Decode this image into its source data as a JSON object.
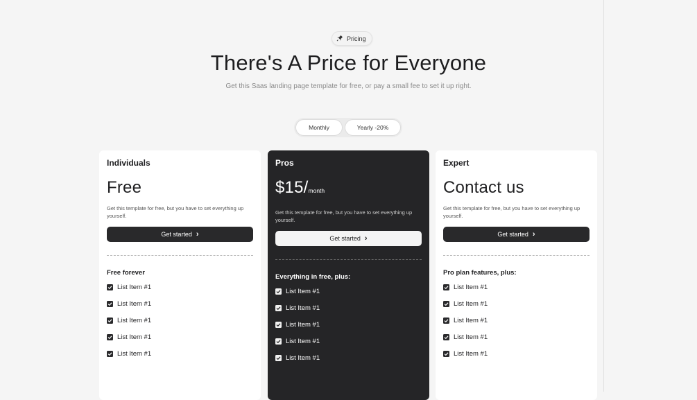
{
  "header": {
    "badge_label": "Pricing",
    "badge_icon": "rocket-icon",
    "title": "There's A Price for Everyone",
    "subtitle": "Get this Saas landing page template for free, or pay a small fee to set it up right."
  },
  "billing_toggle": {
    "monthly_label": "Monthly",
    "yearly_label": "Yearly -20%"
  },
  "plans": [
    {
      "name": "Individuals",
      "price": "Free",
      "price_unit": "",
      "description": "Get this template for free, but you have to set everything up yourself.",
      "cta_label": "Get started",
      "features_heading": "Free forever",
      "features": [
        "List Item #1",
        "List Item #1",
        "List Item #1",
        "List Item #1",
        "List Item #1"
      ]
    },
    {
      "name": "Pros",
      "price": "$15/",
      "price_unit": "month",
      "description": "Get this template for free, but you have to set everything up yourself.",
      "cta_label": "Get started",
      "features_heading": "Everything in free, plus:",
      "features": [
        "List Item #1",
        "List Item #1",
        "List Item #1",
        "List Item #1",
        "List Item #1"
      ]
    },
    {
      "name": "Expert",
      "price": "Contact us",
      "price_unit": "",
      "description": "Get this template for free, but you have to set everything up yourself.",
      "cta_label": "Get started",
      "features_heading": "Pro plan features, plus:",
      "features": [
        "List Item #1",
        "List Item #1",
        "List Item #1",
        "List Item #1",
        "List Item #1"
      ]
    }
  ],
  "colors": {
    "background": "#f5f5f5",
    "dark_card": "#252527",
    "button_dark": "#29292b",
    "text_primary": "#1d1d1f"
  }
}
